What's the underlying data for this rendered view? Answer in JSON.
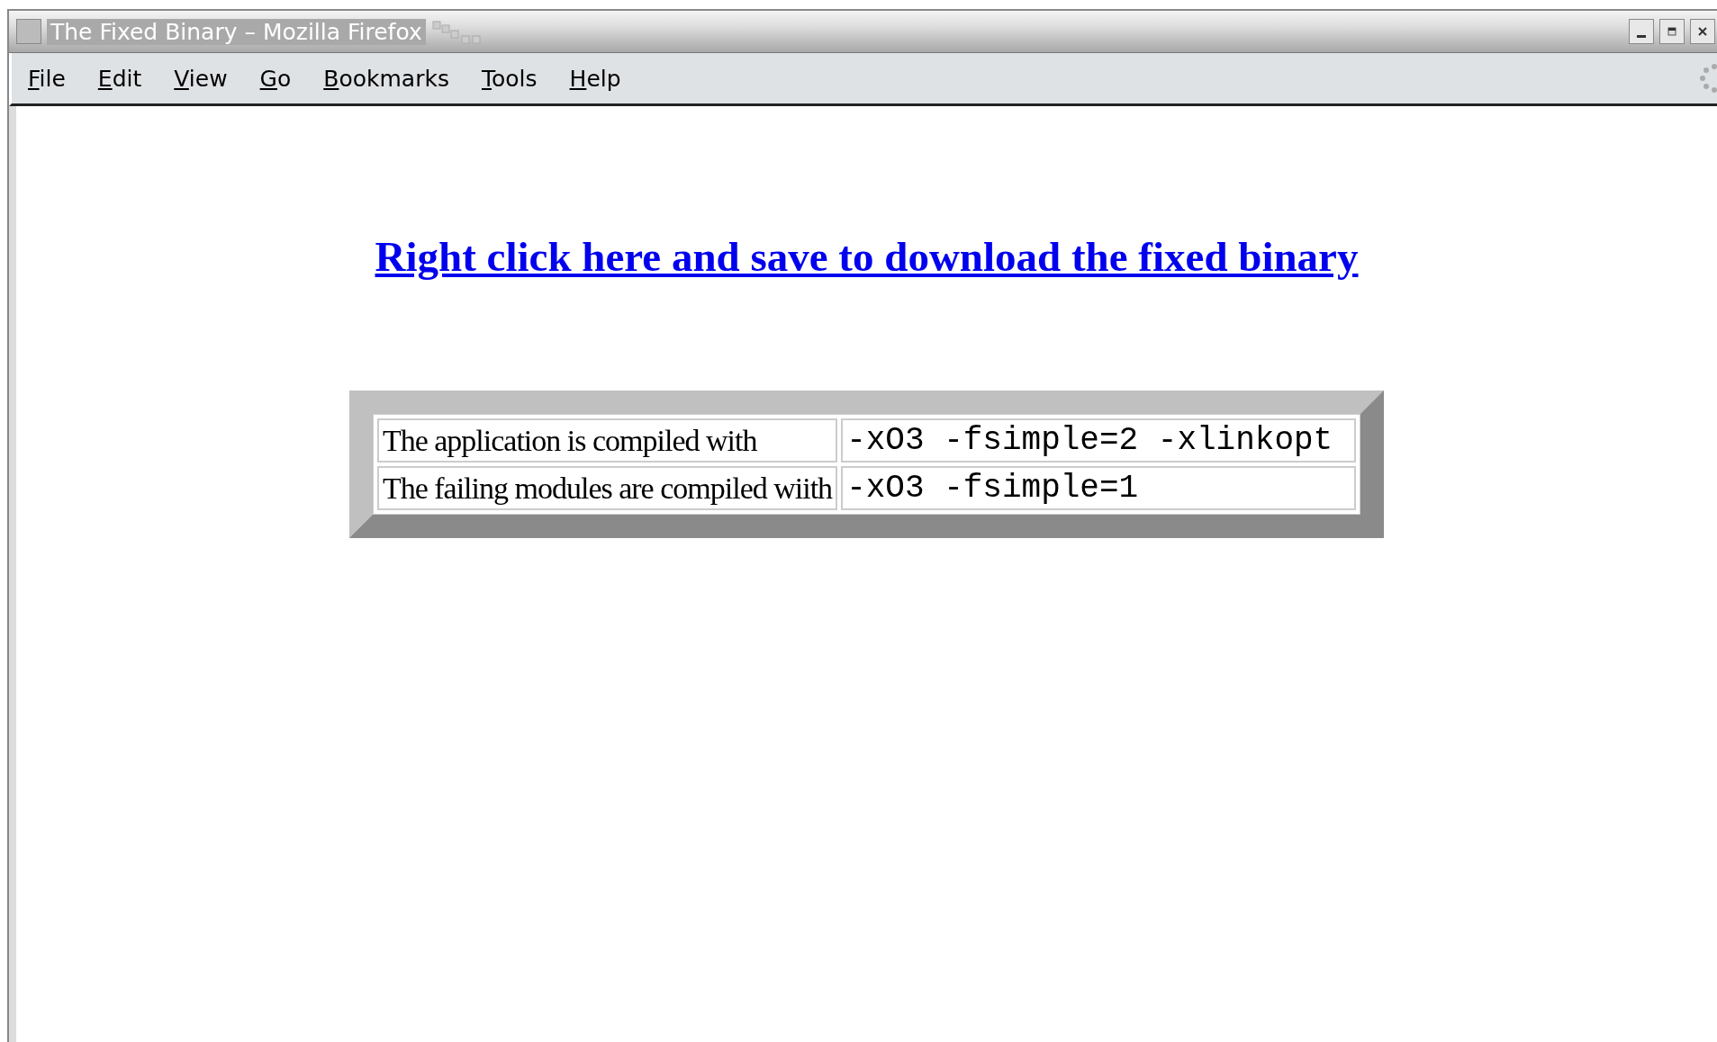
{
  "window": {
    "title": "The Fixed Binary – Mozilla Firefox"
  },
  "menu": [
    "File",
    "Edit",
    "View",
    "Go",
    "Bookmarks",
    "Tools",
    "Help"
  ],
  "link": "Right click here and save to download the fixed binary",
  "table": {
    "rows": [
      {
        "label": "The application is compiled with",
        "flags": "-xO3 -fsimple=2 -xlinkopt"
      },
      {
        "label": "The failing modules are compiled wiith",
        "flags": "-xO3 -fsimple=1"
      }
    ]
  }
}
